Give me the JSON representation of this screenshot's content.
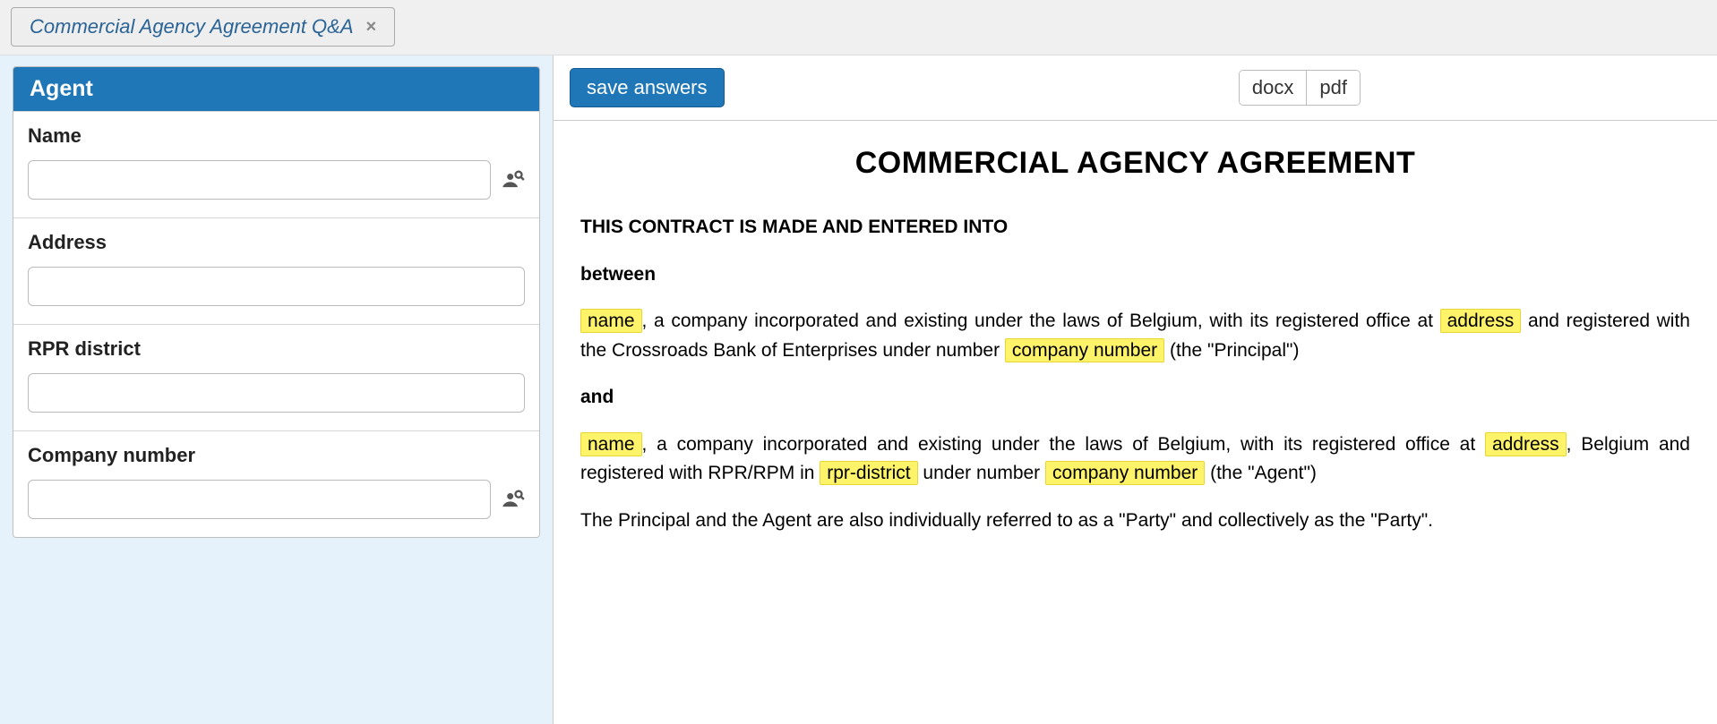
{
  "tab": {
    "title": "Commercial Agency Agreement Q&A"
  },
  "panel": {
    "title": "Agent",
    "fields": {
      "name": {
        "label": "Name",
        "value": "",
        "has_lookup": true
      },
      "address": {
        "label": "Address",
        "value": "",
        "has_lookup": false
      },
      "rpr": {
        "label": "RPR district",
        "value": "",
        "has_lookup": false
      },
      "company_number": {
        "label": "Company number",
        "value": "",
        "has_lookup": true
      }
    }
  },
  "toolbar": {
    "save_label": "save answers",
    "export": {
      "docx": "docx",
      "pdf": "pdf"
    }
  },
  "doc": {
    "title": "COMMERCIAL AGENCY AGREEMENT",
    "intro": "THIS CONTRACT IS MADE AND ENTERED INTO",
    "between": "between",
    "ph": {
      "name": "name",
      "address": "address",
      "company_number": "company number",
      "rpr_district": "rpr-district"
    },
    "p1_seg1": ", a company incorporated and existing under the laws of Belgium, with its registered office at ",
    "p1_seg2": " and registered with the Crossroads Bank of Enterprises under number ",
    "p1_seg3": " (the \"Principal\")",
    "and": "and",
    "p2_seg1": ", a company incorporated and existing under the laws of Belgium, with its registered office at ",
    "p2_seg2": ", Belgium and registered with RPR/RPM in ",
    "p2_seg3": " under number ",
    "p2_seg4": " (the \"Agent\")",
    "closing": "The Principal and the Agent are also individually referred to as a \"Party\" and collectively as the \"Party\"."
  }
}
